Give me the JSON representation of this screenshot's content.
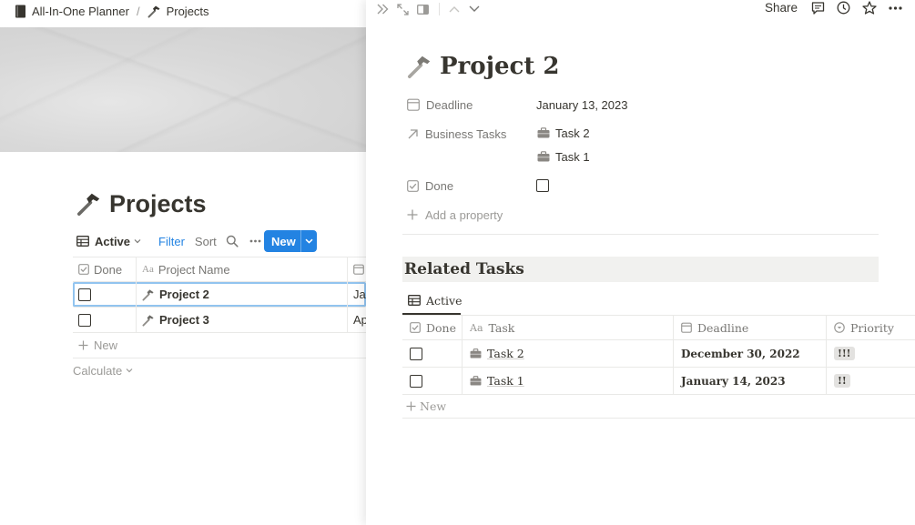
{
  "breadcrumb": {
    "workspace": "All-In-One Planner",
    "separator": "/",
    "page": "Projects"
  },
  "database": {
    "title": "Projects",
    "view_name": "Active",
    "filter_label": "Filter",
    "sort_label": "Sort",
    "new_label": "New",
    "columns": [
      "Done",
      "Project Name",
      ""
    ],
    "rows": [
      {
        "done": false,
        "name": "Project 2",
        "peek": "Ja",
        "selected": true
      },
      {
        "done": false,
        "name": "Project 3",
        "peek": "Ap",
        "selected": false
      }
    ],
    "add_row_label": "New",
    "calculate_label": "Calculate"
  },
  "peek": {
    "share_label": "Share",
    "title": "Project 2",
    "properties": {
      "deadline_label": "Deadline",
      "deadline_value": "January 13, 2023",
      "business_tasks_label": "Business Tasks",
      "business_tasks": [
        "Task 2",
        "Task 1"
      ],
      "done_label": "Done",
      "add_property_label": "Add a property"
    },
    "related": {
      "heading": "Related Tasks",
      "view_name": "Active",
      "columns": [
        "Done",
        "Task",
        "Deadline",
        "Priority"
      ],
      "rows": [
        {
          "done": false,
          "task": "Task 2",
          "deadline": "December 30, 2022",
          "priority": "!!!"
        },
        {
          "done": false,
          "task": "Task 1",
          "deadline": "January 14, 2023",
          "priority": "!!"
        }
      ],
      "add_row_label": "New"
    }
  },
  "colors": {
    "accent": "#2383e2",
    "text": "#37352f",
    "muted": "#787774",
    "border": "#e9e9e7"
  },
  "icons": {
    "workspace": "notebook-icon",
    "projects": "hammer-icon",
    "tasks": "briefcase-icon"
  }
}
